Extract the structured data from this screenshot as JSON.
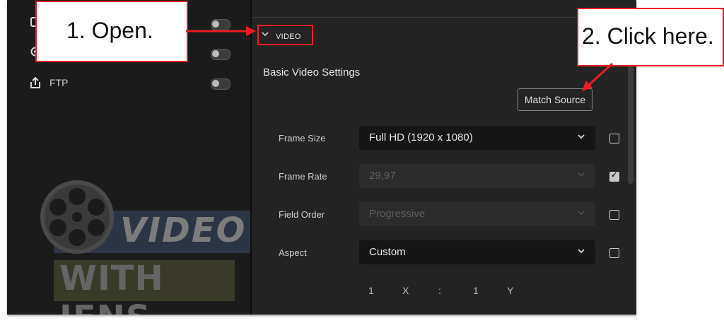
{
  "publish_list": [
    {
      "icon": "square-icon",
      "label": ""
    },
    {
      "icon": "circle-icon",
      "label": ""
    },
    {
      "icon": "share-upload-icon",
      "label": "FTP"
    }
  ],
  "watermark": {
    "line1": "VIDEO",
    "line2": "WITH JENS"
  },
  "video_section": {
    "header": "VIDEO",
    "subheading": "Basic Video Settings",
    "match_source_label": "Match Source",
    "settings": [
      {
        "label": "Frame Size",
        "value": "Full HD (1920 x 1080)",
        "enabled": true,
        "checked": false
      },
      {
        "label": "Frame Rate",
        "value": "29,97",
        "enabled": false,
        "checked": true
      },
      {
        "label": "Field Order",
        "value": "Progressive",
        "enabled": false,
        "checked": false
      },
      {
        "label": "Aspect",
        "value": "Custom",
        "enabled": true,
        "checked": false
      }
    ],
    "aspect_fields": [
      "1",
      "X",
      ":",
      "1",
      "Y"
    ]
  },
  "annotations": {
    "step1": "1. Open.",
    "step2": "2. Click here."
  },
  "colors": {
    "annotation_red": "#ea1d25",
    "panel_bg": "#232323",
    "sidebar_bg": "#1b1b1b"
  }
}
